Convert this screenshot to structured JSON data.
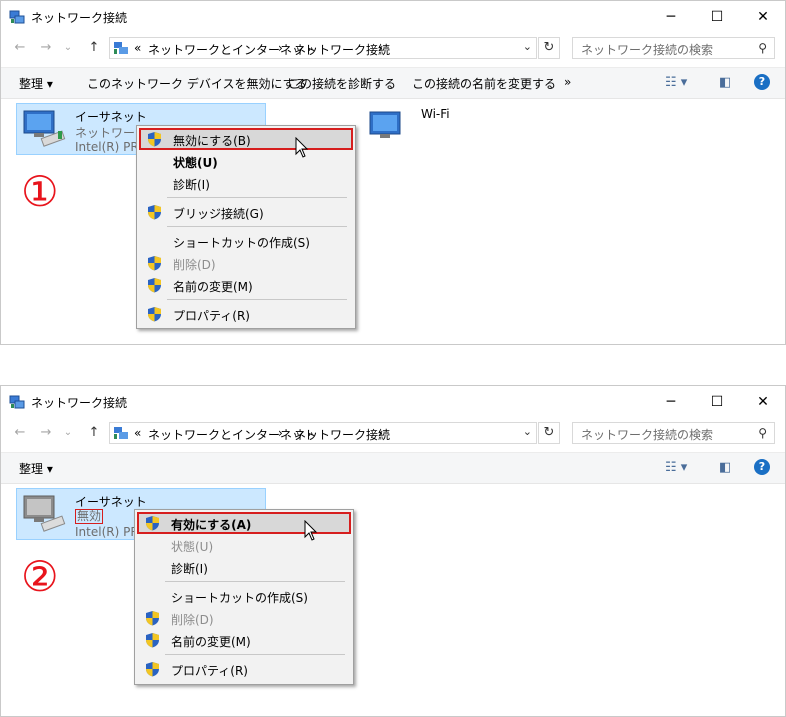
{
  "window_title": "ネットワーク接続",
  "title_buttons": {
    "minimize": "─",
    "maximize": "☐",
    "close": "✕"
  },
  "nav": {
    "back": "←",
    "forward": "→",
    "recent": "⌄",
    "up": "↑"
  },
  "breadcrumb": {
    "overflow": "«",
    "part1": "ネットワークとインターネット",
    "sep": "›",
    "part2": "ネットワーク接続",
    "sep2": "›"
  },
  "address_dropdown": "⌄",
  "refresh": "↻",
  "search_placeholder": "ネットワーク接続の検索",
  "search_glyph": "⚲",
  "panel1": {
    "toolbar": {
      "organize": "整理 ▾",
      "disable_device": "このネットワーク デバイスを無効にする",
      "diagnose": "この接続を診断する",
      "rename": "この接続の名前を変更する",
      "more": "»"
    },
    "ethernet": {
      "name": "イーサネット",
      "status": "ネットワーク",
      "adapter": "Intel(R) PRO"
    },
    "wifi": {
      "name": "Wi-Fi"
    },
    "marker": "①",
    "menu": [
      {
        "label": "無効にする(B)",
        "icon": "shield-icon",
        "highlight": true
      },
      {
        "label": "状態(U)",
        "bold": true
      },
      {
        "label": "診断(I)"
      },
      {
        "label": "ブリッジ接続(G)",
        "icon": "shield-icon"
      },
      {
        "label": "ショートカットの作成(S)"
      },
      {
        "label": "削除(D)",
        "icon": "shield-icon",
        "disabled": true
      },
      {
        "label": "名前の変更(M)",
        "icon": "shield-icon"
      },
      {
        "label": "プロパティ(R)",
        "icon": "shield-icon"
      }
    ]
  },
  "panel2": {
    "toolbar": {
      "organize": "整理 ▾"
    },
    "ethernet": {
      "name": "イーサネット",
      "status": "無効",
      "adapter": "Intel(R) PRO"
    },
    "marker": "②",
    "menu": [
      {
        "label": "有効にする(A)",
        "icon": "shield-icon",
        "highlight": true,
        "bold": true
      },
      {
        "label": "状態(U)",
        "disabled": true
      },
      {
        "label": "診断(I)"
      },
      {
        "label": "ショートカットの作成(S)"
      },
      {
        "label": "削除(D)",
        "icon": "shield-icon",
        "disabled": true
      },
      {
        "label": "名前の変更(M)",
        "icon": "shield-icon"
      },
      {
        "label": "プロパティ(R)",
        "icon": "shield-icon"
      }
    ]
  },
  "colors": {
    "accent": "#cce8ff",
    "highlight_border": "#d61e1e",
    "marker": "#e8141c",
    "help": "#1a6fc4"
  }
}
